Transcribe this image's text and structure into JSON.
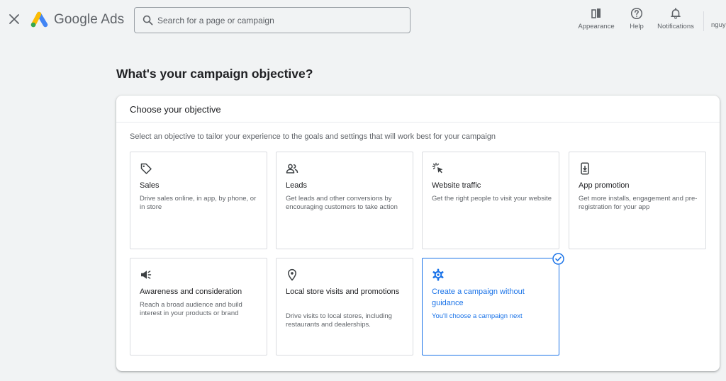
{
  "topbar": {
    "brand": "Google Ads",
    "search_placeholder": "Search for a page or campaign",
    "appearance_label": "Appearance",
    "help_label": "Help",
    "notifications_label": "Notifications",
    "user": "nguy"
  },
  "page": {
    "title": "What's your campaign objective?"
  },
  "panel": {
    "heading": "Choose your objective",
    "description": "Select an objective to tailor your experience to the goals and settings that will work best for your campaign"
  },
  "objectives": [
    {
      "title": "Sales",
      "desc": "Drive sales online, in app, by phone, or in store",
      "icon": "tag-icon"
    },
    {
      "title": "Leads",
      "desc": "Get leads and other conversions by encouraging customers to take action",
      "icon": "people-icon"
    },
    {
      "title": "Website traffic",
      "desc": "Get the right people to visit your website",
      "icon": "cursor-click-icon"
    },
    {
      "title": "App promotion",
      "desc": "Get more installs, engagement and pre-registration for your app",
      "icon": "phone-download-icon"
    },
    {
      "title": "Awareness and consideration",
      "desc": "Reach a broad audience and build interest in your products or brand",
      "icon": "megaphone-icon"
    },
    {
      "title": "Local store visits and promotions",
      "desc": "Drive visits to local stores, including restaurants and dealerships.",
      "icon": "location-pin-icon"
    },
    {
      "title": "Create a campaign without guidance",
      "desc": "You'll choose a campaign next",
      "icon": "gear-icon",
      "selected": true
    }
  ],
  "colors": {
    "accent": "#1a73e8",
    "background": "#f1f3f4",
    "card_border": "#dadce0"
  }
}
